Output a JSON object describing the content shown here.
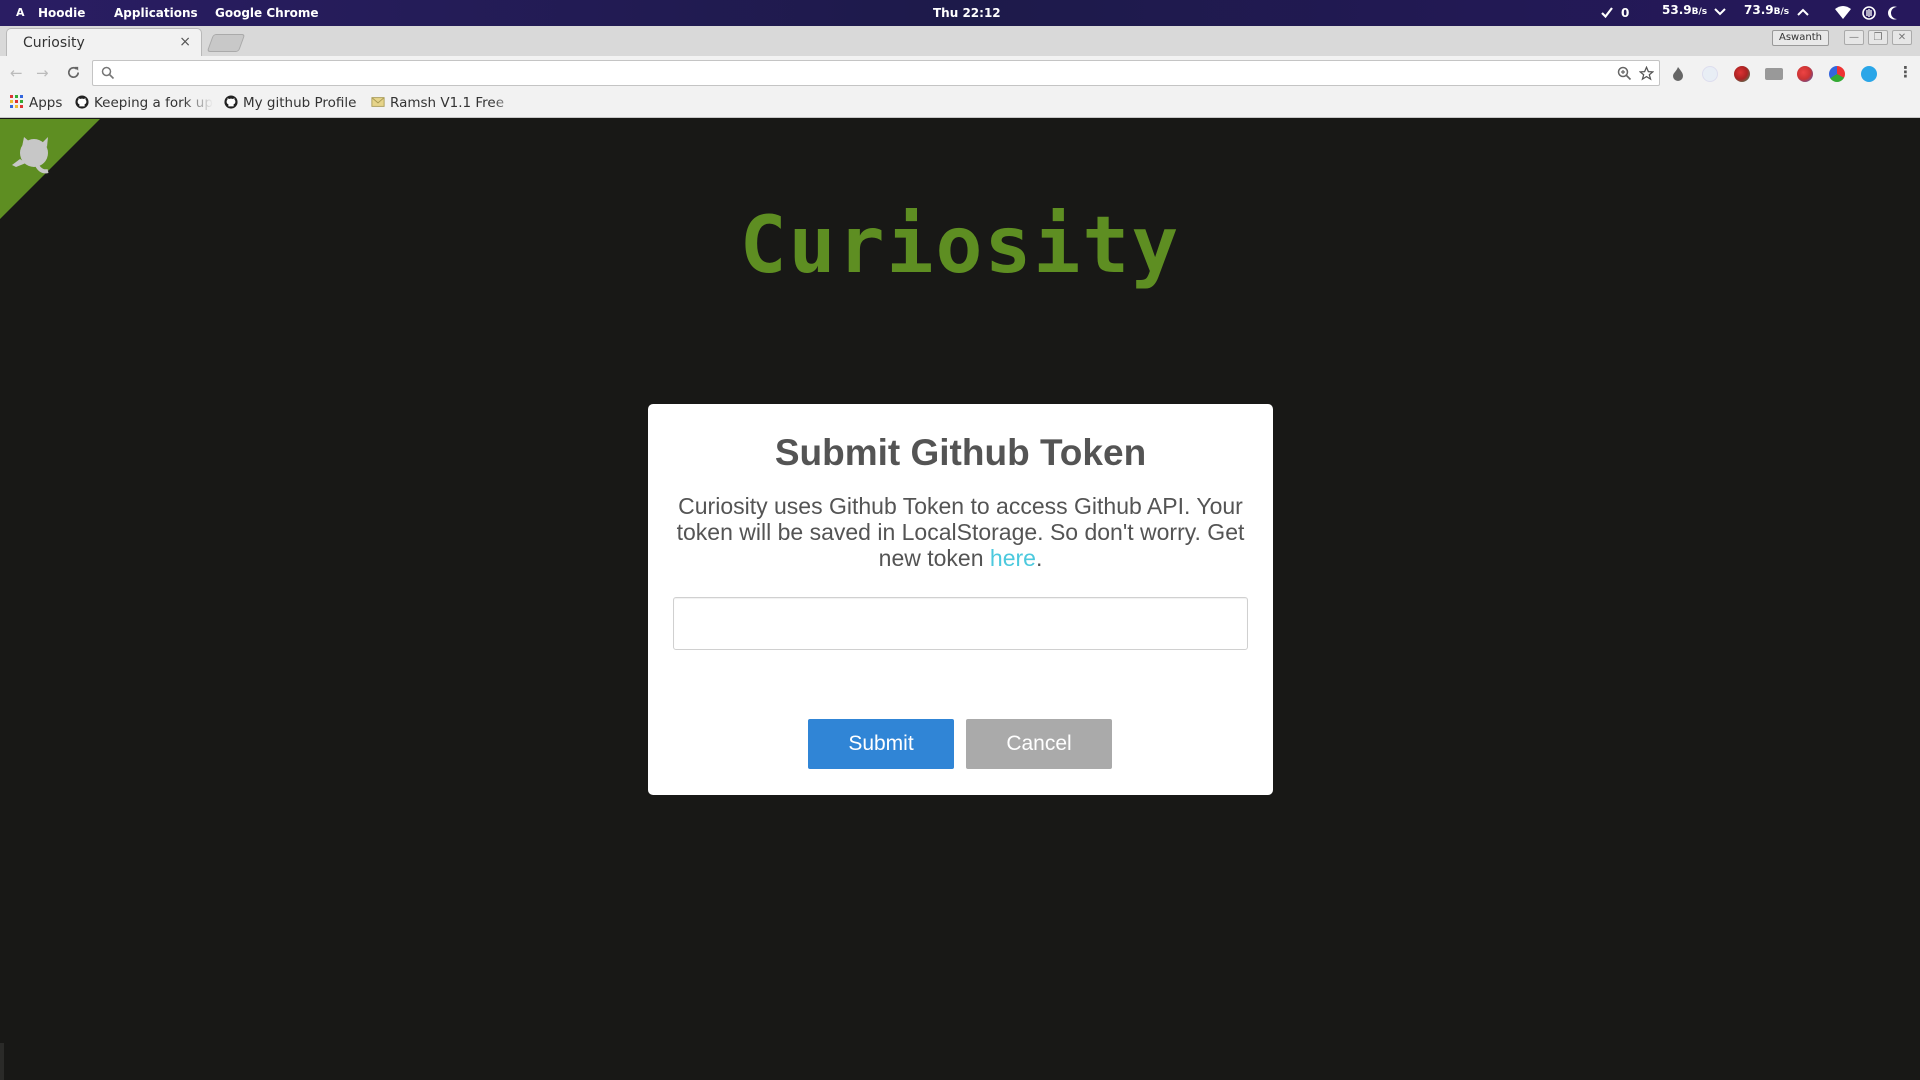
{
  "topbar": {
    "activities_glyph": "A",
    "user": "Hoodie",
    "applications": "Applications",
    "app_name": "Google Chrome",
    "clock": "Thu 22:12",
    "task_count": "0",
    "net_down": "53.9",
    "net_down_unit": "B/s",
    "net_up": "73.9",
    "net_up_unit": "B/s"
  },
  "browser": {
    "tab_title": "Curiosity",
    "tab_close": "×",
    "profile_name": "Aswanth",
    "omnibox_value": "",
    "omnibox_placeholder": ""
  },
  "bookmarks": [
    {
      "label": "Apps",
      "icon": "apps-grid-icon"
    },
    {
      "label": "Keeping a fork up",
      "icon": "github-icon"
    },
    {
      "label": "My github Profile",
      "icon": "github-icon"
    },
    {
      "label": "Ramsh V1.1 Free",
      "icon": "envelope-icon"
    }
  ],
  "page": {
    "app_title": "Curiosity",
    "brand_color": "#5e8e22"
  },
  "modal": {
    "title": "Submit Github Token",
    "text_before_link": "Curiosity uses Github Token to access Github API. Your token will be saved in LocalStorage. So don't worry. Get new token ",
    "link_text": "here",
    "text_after_link": ".",
    "input_value": "",
    "submit_label": "Submit",
    "cancel_label": "Cancel",
    "submit_color": "#3085d6",
    "cancel_color": "#aaaaaa",
    "link_color": "#4cc9de"
  }
}
